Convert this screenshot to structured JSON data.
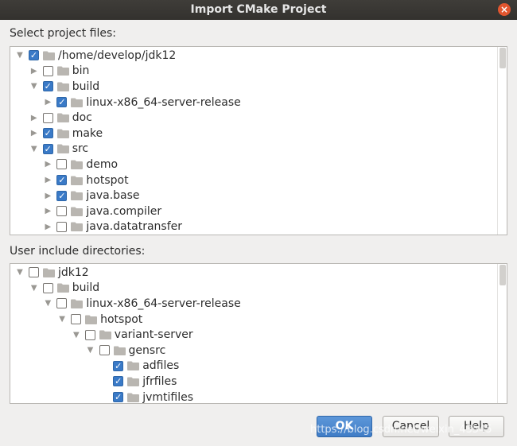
{
  "window": {
    "title": "Import CMake Project",
    "close_icon": "×"
  },
  "project_files": {
    "label": "Select project files:",
    "rows": [
      {
        "label": "/home/develop/jdk12",
        "depth": 0,
        "expanded": true,
        "checked": true
      },
      {
        "label": "bin",
        "depth": 1,
        "expanded": false,
        "checked": false
      },
      {
        "label": "build",
        "depth": 1,
        "expanded": true,
        "checked": true
      },
      {
        "label": "linux-x86_64-server-release",
        "depth": 2,
        "expanded": false,
        "checked": true
      },
      {
        "label": "doc",
        "depth": 1,
        "expanded": false,
        "checked": false
      },
      {
        "label": "make",
        "depth": 1,
        "expanded": false,
        "checked": true
      },
      {
        "label": "src",
        "depth": 1,
        "expanded": true,
        "checked": true
      },
      {
        "label": "demo",
        "depth": 2,
        "expanded": false,
        "checked": false
      },
      {
        "label": "hotspot",
        "depth": 2,
        "expanded": false,
        "checked": true
      },
      {
        "label": "java.base",
        "depth": 2,
        "expanded": false,
        "checked": true
      },
      {
        "label": "java.compiler",
        "depth": 2,
        "expanded": false,
        "checked": false
      },
      {
        "label": "java.datatransfer",
        "depth": 2,
        "expanded": false,
        "checked": false
      }
    ]
  },
  "include_dirs": {
    "label": "User include directories:",
    "rows": [
      {
        "label": "jdk12",
        "depth": 0,
        "expanded": true,
        "checked": false
      },
      {
        "label": "build",
        "depth": 1,
        "expanded": true,
        "checked": false
      },
      {
        "label": "linux-x86_64-server-release",
        "depth": 2,
        "expanded": true,
        "checked": false
      },
      {
        "label": "hotspot",
        "depth": 3,
        "expanded": true,
        "checked": false
      },
      {
        "label": "variant-server",
        "depth": 4,
        "expanded": true,
        "checked": false
      },
      {
        "label": "gensrc",
        "depth": 5,
        "expanded": true,
        "checked": false
      },
      {
        "label": "adfiles",
        "depth": 6,
        "leaf": true,
        "checked": true
      },
      {
        "label": "jfrfiles",
        "depth": 6,
        "leaf": true,
        "checked": true
      },
      {
        "label": "jvmtifiles",
        "depth": 6,
        "leaf": true,
        "checked": true
      }
    ]
  },
  "buttons": {
    "ok": "OK",
    "cancel": "Cancel",
    "help": "Help"
  },
  "watermark": "https://blog.csdn.net/weixin_43545",
  "colors": {
    "accent": "#3a7ac7",
    "titlebar": "#3a3835",
    "folder": "#b9b6b1"
  },
  "icons": {
    "expanded": "chevron-down-icon",
    "collapsed": "chevron-right-icon",
    "folder": "folder-icon",
    "close": "close-icon"
  }
}
